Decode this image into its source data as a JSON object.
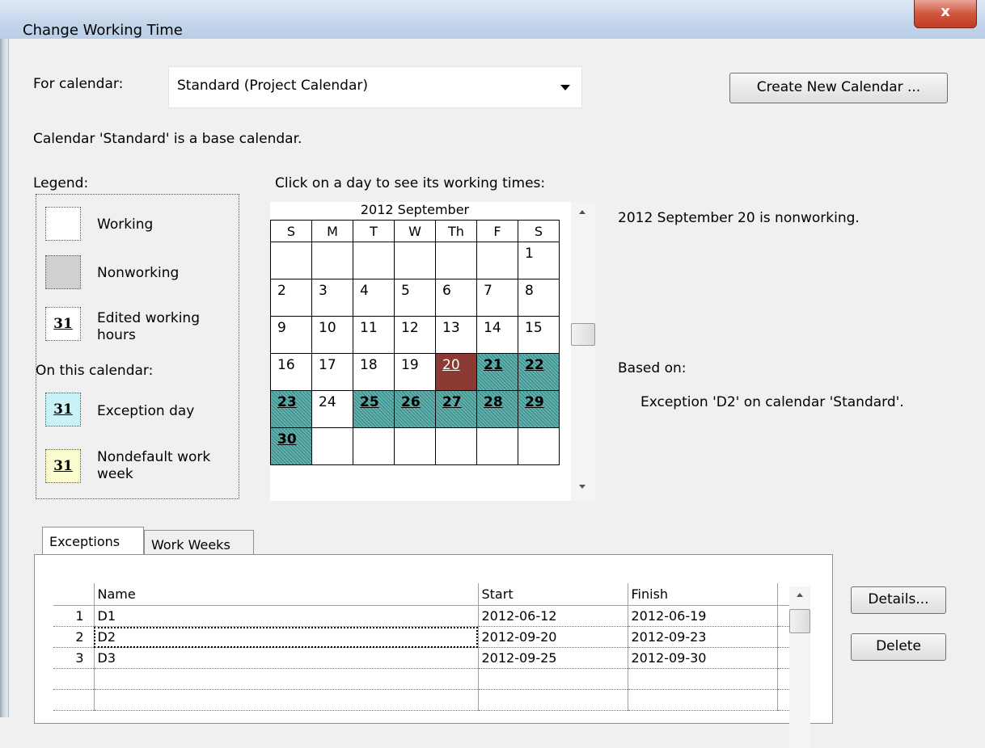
{
  "window": {
    "title": "Change Working Time",
    "close_glyph": "x"
  },
  "for_calendar": {
    "label": "For calendar:",
    "value": "Standard (Project Calendar)"
  },
  "create_button": "Create New Calendar ...",
  "base_calendar_note": "Calendar 'Standard' is a base calendar.",
  "legend": {
    "title": "Legend:",
    "working": "Working",
    "nonworking": "Nonworking",
    "edited_num": "31",
    "edited_line1": "Edited working",
    "edited_line2": "hours",
    "on_calendar": "On this calendar:",
    "exception_num": "31",
    "exception": "Exception day",
    "nondefault_num": "31",
    "nondefault_line1": "Nondefault work",
    "nondefault_line2": "week"
  },
  "calendar": {
    "instruction": "Click on a day to see its working times:",
    "month": "2012 September",
    "weekdays": [
      "S",
      "M",
      "T",
      "W",
      "Th",
      "F",
      "S"
    ],
    "weeks": [
      [
        "",
        "",
        "",
        "",
        "",
        "",
        "1"
      ],
      [
        "2",
        "3",
        "4",
        "5",
        "6",
        "7",
        "8"
      ],
      [
        "9",
        "10",
        "11",
        "12",
        "13",
        "14",
        "15"
      ],
      [
        "16",
        "17",
        "18",
        "19",
        "20",
        "21",
        "22"
      ],
      [
        "23",
        "24",
        "25",
        "26",
        "27",
        "28",
        "29"
      ],
      [
        "30",
        "",
        "",
        "",
        "",
        "",
        ""
      ]
    ],
    "exception_days": [
      "21",
      "22",
      "23",
      "25",
      "26",
      "27",
      "28",
      "29",
      "30"
    ],
    "selected_day": "20"
  },
  "info": {
    "status": "2012 September 20 is nonworking.",
    "based_on_label": "Based on:",
    "based_on_value": "Exception 'D2' on calendar 'Standard'."
  },
  "tabs": {
    "exceptions": "Exceptions",
    "work_weeks": "Work Weeks"
  },
  "exceptions_table": {
    "columns": [
      "Name",
      "Start",
      "Finish"
    ],
    "rows": [
      {
        "num": "1",
        "name": "D1",
        "start": "2012-06-12",
        "finish": "2012-06-19"
      },
      {
        "num": "2",
        "name": "D2",
        "start": "2012-09-20",
        "finish": "2012-09-23"
      },
      {
        "num": "3",
        "name": "D3",
        "start": "2012-09-25",
        "finish": "2012-09-30"
      }
    ]
  },
  "details_button": "Details...",
  "delete_button": "Delete",
  "colors": {
    "exception": "#3d9693",
    "selected": "#8c3a34",
    "exception_swatch": "#c9f3f7",
    "nondefault_swatch": "#fbfbd0"
  }
}
